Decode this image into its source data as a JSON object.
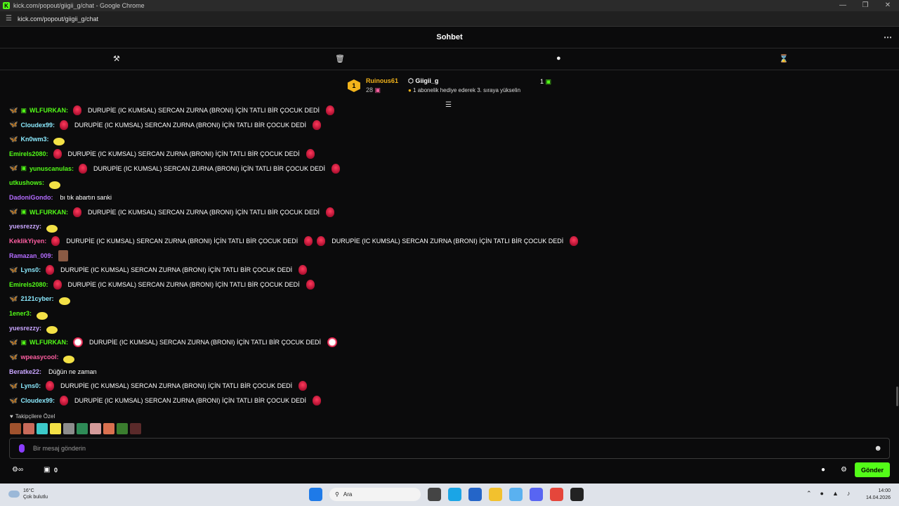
{
  "browser": {
    "title": "kick.com/popout/giigii_g/chat - Google Chrome",
    "url": "kick.com/popout/giigii_g/chat",
    "favicon": "K"
  },
  "chat": {
    "header_title": "Sohbet",
    "pinned": {
      "rank": "1",
      "user": "Ruinous61",
      "user_count": "28",
      "channel": "Giigii_g",
      "subtitle": "1 abonelik hediye ederek 3. sıraya yükselin",
      "count": "1"
    },
    "messages": [
      {
        "user": "WLFURKAN:",
        "color": "#53fc18",
        "badges": [
          "🦋"
        ],
        "gift": true,
        "parts": [
          {
            "e": "red"
          },
          {
            "t": "DURUPİE (IC KUMSAL) SERCAN ZURNA (BRONI) İÇİN TATLI BİR ÇOCUK DEDİ"
          },
          {
            "e": "red"
          }
        ]
      },
      {
        "user": "Cloudex99:",
        "color": "#8be9fd",
        "badges": [
          "🦋"
        ],
        "parts": [
          {
            "e": "red"
          },
          {
            "t": "DURUPİE (IC KUMSAL) SERCAN ZURNA (BRONI) İÇİN TATLI BİR ÇOCUK DEDİ"
          },
          {
            "e": "red"
          }
        ]
      },
      {
        "user": "Kn0wm3:",
        "color": "#8be9fd",
        "badges": [
          "🦋"
        ],
        "parts": [
          {
            "e": "yellow"
          }
        ]
      },
      {
        "user": "Emirels2080:",
        "color": "#53fc18",
        "parts": [
          {
            "e": "red"
          },
          {
            "t": "DURUPİE (IC KUMSAL) SERCAN ZURNA (BRONI) İÇİN TATLI BİR ÇOCUK DEDİ"
          },
          {
            "e": "red"
          }
        ]
      },
      {
        "user": "yunuscanulas:",
        "color": "#53fc18",
        "badges": [
          "🦋"
        ],
        "gift": true,
        "parts": [
          {
            "e": "red"
          },
          {
            "t": "DURUPİE (IC KUMSAL) SERCAN ZURNA (BRONI) İÇİN TATLI BİR ÇOCUK DEDİ"
          },
          {
            "e": "red"
          }
        ]
      },
      {
        "user": "utkushows:",
        "color": "#53fc18",
        "parts": [
          {
            "e": "yellow"
          }
        ]
      },
      {
        "user": "DadoniGondo:",
        "color": "#b46cff",
        "parts": [
          {
            "t": "bı tık abartın sanki"
          }
        ]
      },
      {
        "user": "WLFURKAN:",
        "color": "#53fc18",
        "badges": [
          "🦋"
        ],
        "gift": true,
        "parts": [
          {
            "e": "red"
          },
          {
            "t": "DURUPİE (IC KUMSAL) SERCAN ZURNA (BRONI) İÇİN TATLI BİR ÇOCUK DEDİ"
          },
          {
            "e": "red"
          }
        ]
      },
      {
        "user": "yuesrezzy:",
        "color": "#c9a6ff",
        "parts": [
          {
            "e": "yellow"
          }
        ]
      },
      {
        "user": "KeklikYiyen:",
        "color": "#ff5fa2",
        "parts": [
          {
            "e": "red"
          },
          {
            "t": "DURUPİE (IC KUMSAL) SERCAN ZURNA (BRONI) İÇİN TATLI BİR ÇOCUK DEDİ"
          },
          {
            "e": "red"
          },
          {
            "e": "red"
          },
          {
            "t": "DURUPİE (IC KUMSAL) SERCAN ZURNA (BRONI) İÇİN TATLI BİR ÇOCUK DEDİ"
          },
          {
            "e": "red"
          }
        ]
      },
      {
        "user": "Ramazan_009:",
        "color": "#b46cff",
        "parts": [
          {
            "e": "face"
          }
        ]
      },
      {
        "user": "Lyns0:",
        "color": "#8be9fd",
        "badges": [
          "🦋"
        ],
        "parts": [
          {
            "e": "red"
          },
          {
            "t": "DURUPİE (IC KUMSAL) SERCAN ZURNA (BRONI) İÇİN TATLI BİR ÇOCUK DEDİ"
          },
          {
            "e": "red"
          }
        ]
      },
      {
        "user": "Emirels2080:",
        "color": "#53fc18",
        "parts": [
          {
            "e": "red"
          },
          {
            "t": "DURUPİE (IC KUMSAL) SERCAN ZURNA (BRONI) İÇİN TATLI BİR ÇOCUK DEDİ"
          },
          {
            "e": "red"
          }
        ]
      },
      {
        "user": "2121cyber:",
        "color": "#8be9fd",
        "badges": [
          "🦋"
        ],
        "parts": [
          {
            "e": "yellow"
          }
        ]
      },
      {
        "user": "1ener3:",
        "color": "#53fc18",
        "parts": [
          {
            "e": "yellow"
          }
        ]
      },
      {
        "user": "yuesrezzy:",
        "color": "#c9a6ff",
        "parts": [
          {
            "e": "yellow"
          }
        ]
      },
      {
        "user": "WLFURKAN:",
        "color": "#53fc18",
        "badges": [
          "🦋"
        ],
        "gift": true,
        "parts": [
          {
            "e": "white"
          },
          {
            "t": "DURUPİE (IC KUMSAL) SERCAN ZURNA (BRONI) İÇİN TATLI BİR ÇOCUK DEDİ"
          },
          {
            "e": "white"
          }
        ]
      },
      {
        "user": "wpeasycool:",
        "color": "#ff5fa2",
        "badges": [
          "🦋"
        ],
        "parts": [
          {
            "e": "yellow"
          }
        ]
      },
      {
        "user": "Beratke22:",
        "color": "#c9a6ff",
        "parts": [
          {
            "t": "Düğün ne zaman"
          }
        ]
      },
      {
        "user": "Lyns0:",
        "color": "#8be9fd",
        "badges": [
          "🦋"
        ],
        "parts": [
          {
            "e": "red"
          },
          {
            "t": "DURUPİE (IC KUMSAL) SERCAN ZURNA (BRONI) İÇİN TATLI BİR ÇOCUK DEDİ"
          },
          {
            "e": "red"
          }
        ]
      },
      {
        "user": "Cloudex99:",
        "color": "#8be9fd",
        "badges": [
          "🦋"
        ],
        "parts": [
          {
            "e": "red"
          },
          {
            "t": "DURUPİE (IC KUMSAL) SERCAN ZURNA (BRONI) İÇİN TATLI BİR ÇOCUK DEDİ"
          },
          {
            "e": "red"
          }
        ]
      }
    ],
    "followers_label": "Takipçilere Özel",
    "emote_colors": [
      "#a0522d",
      "#c86a5a",
      "#3cc9c9",
      "#f3e146",
      "#8c8c8c",
      "#2e8b57",
      "#d49a9a",
      "#d9704f",
      "#3a7d2e",
      "#5a2a2a"
    ],
    "input_placeholder": "Bir mesaj gönderin",
    "bottom_count": "0",
    "send_label": "Gönder"
  },
  "taskbar": {
    "temp": "16°C",
    "weather": "Çok bulutlu",
    "search": "Ara",
    "time": "14:00",
    "date": "14.04.2026"
  }
}
